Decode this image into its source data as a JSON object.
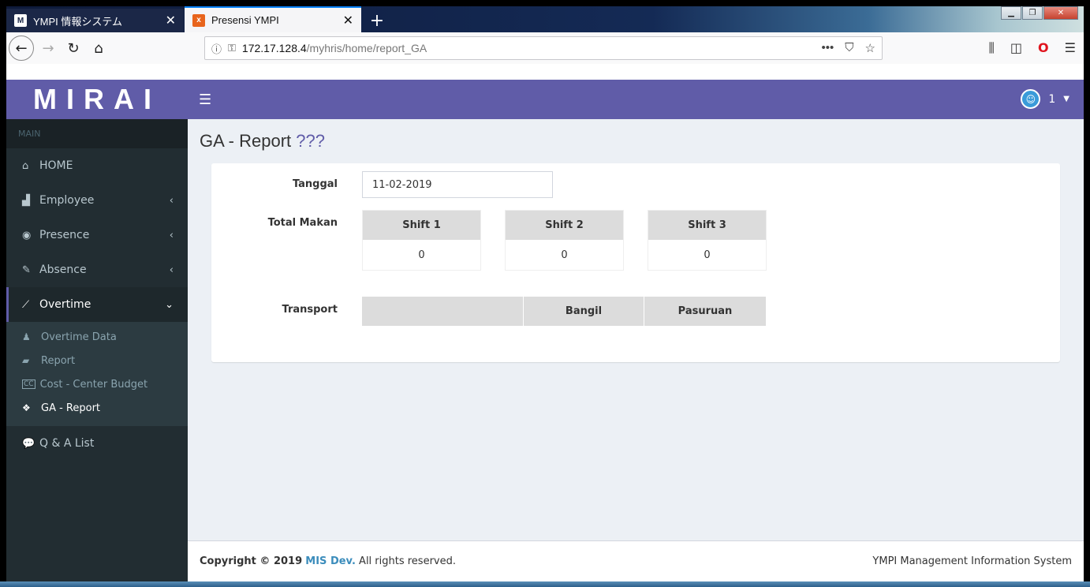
{
  "browser": {
    "tabs": [
      {
        "label": "YMPI 情報システム",
        "favicon": "M",
        "active": false
      },
      {
        "label": "Presensi YMPI",
        "favicon": "x",
        "active": true
      }
    ],
    "url_host": "172.17.128.4",
    "url_path": "/myhris/home/report_GA"
  },
  "app": {
    "brand": "MIRAI",
    "user_label": "1"
  },
  "sidebar": {
    "header": "MAIN",
    "items": [
      {
        "label": "HOME",
        "icon": "home-icon"
      },
      {
        "label": "Employee",
        "icon": "industry-icon"
      },
      {
        "label": "Presence",
        "icon": "eye-icon"
      },
      {
        "label": "Absence",
        "icon": "edit-icon"
      },
      {
        "label": "Overtime",
        "icon": "line-chart-icon"
      }
    ],
    "submenu": [
      {
        "label": "Overtime Data",
        "icon": "person-icon"
      },
      {
        "label": "Report",
        "icon": "book-icon"
      },
      {
        "label": "Cost - Center Budget",
        "icon": "cc-icon"
      },
      {
        "label": "GA - Report",
        "icon": "cubes-icon"
      }
    ],
    "qa": {
      "label": "Q & A List",
      "icon": "comments-icon"
    }
  },
  "main": {
    "title": "GA - Report",
    "subtitle": "???",
    "tanggal_label": "Tanggal",
    "tanggal_value": "11-02-2019",
    "total_makan_label": "Total Makan",
    "shifts": [
      {
        "name": "Shift 1",
        "value": "0"
      },
      {
        "name": "Shift 2",
        "value": "0"
      },
      {
        "name": "Shift 3",
        "value": "0"
      }
    ],
    "transport_label": "Transport",
    "transport_headers": [
      "",
      "Bangil",
      "Pasuruan"
    ]
  },
  "footer": {
    "copyright_prefix": "Copyright © 2019",
    "company": "MIS Dev.",
    "rights": "All rights reserved.",
    "right_text": "YMPI Management Information System"
  },
  "colors": {
    "accent": "#605ca8",
    "sidebar": "#222d32",
    "link": "#3c8dbc"
  }
}
